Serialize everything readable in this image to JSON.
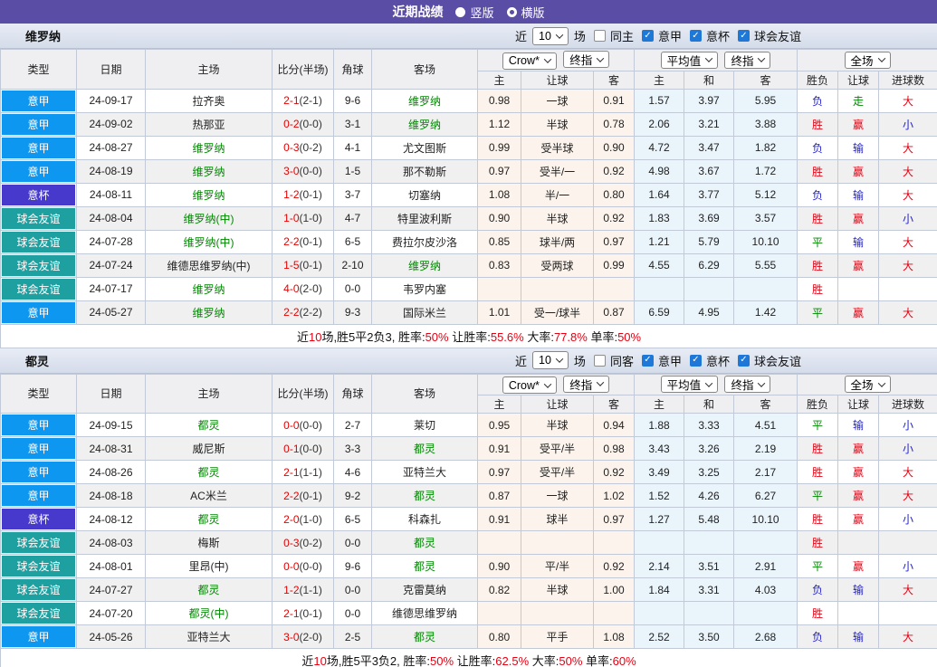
{
  "topbar": {
    "title": "近期战绩",
    "options": [
      {
        "label": "竖版",
        "selected": true
      },
      {
        "label": "横版",
        "selected": false
      }
    ]
  },
  "filter_labels": {
    "near": "近",
    "count": "10",
    "games": "场",
    "leagues": [
      "意甲",
      "意杯",
      "球会友谊"
    ]
  },
  "header": {
    "static_cols": [
      "类型",
      "日期",
      "主场",
      "比分(半场)",
      "角球",
      "客场"
    ],
    "odds_selects": [
      "Crow*",
      "终指"
    ],
    "odds_cols": [
      "主",
      "让球",
      "客"
    ],
    "avg_selects": [
      "平均值",
      "终指"
    ],
    "avg_cols": [
      "主",
      "和",
      "客"
    ],
    "full_select": "全场",
    "full_cols": [
      "胜负",
      "让球",
      "进球数"
    ]
  },
  "colors": {
    "league_type": {
      "意甲": "#0d97f0",
      "意杯": "#4639cc",
      "球会友谊": "#1fa0a0"
    },
    "outcome": {
      "red": "#e60012",
      "green": "#008800",
      "blue": "#2323cc"
    },
    "focal_team": "#008800",
    "score_fulltime": "#e60000",
    "topbar_bg": "#5a4da6"
  },
  "teams": [
    {
      "name": "维罗纳",
      "same_side_label": "同主",
      "rows": [
        {
          "type": "意甲",
          "date": "24-09-17",
          "home": "拉齐奥",
          "home_focal": false,
          "score": "2-1",
          "half": "(2-1)",
          "corners": "9-6",
          "away": "维罗纳",
          "away_focal": true,
          "odds": [
            "0.98",
            "一球",
            "0.91"
          ],
          "avg": [
            "1.57",
            "3.97",
            "5.95"
          ],
          "outcomes": [
            "负",
            "走",
            "大"
          ]
        },
        {
          "type": "意甲",
          "date": "24-09-02",
          "home": "热那亚",
          "home_focal": false,
          "score": "0-2",
          "half": "(0-0)",
          "corners": "3-1",
          "away": "维罗纳",
          "away_focal": true,
          "odds": [
            "1.12",
            "半球",
            "0.78"
          ],
          "avg": [
            "2.06",
            "3.21",
            "3.88"
          ],
          "outcomes": [
            "胜",
            "赢",
            "小"
          ]
        },
        {
          "type": "意甲",
          "date": "24-08-27",
          "home": "维罗纳",
          "home_focal": true,
          "score": "0-3",
          "half": "(0-2)",
          "corners": "4-1",
          "away": "尤文图斯",
          "away_focal": false,
          "odds": [
            "0.99",
            "受半球",
            "0.90"
          ],
          "avg": [
            "4.72",
            "3.47",
            "1.82"
          ],
          "outcomes": [
            "负",
            "输",
            "大"
          ]
        },
        {
          "type": "意甲",
          "date": "24-08-19",
          "home": "维罗纳",
          "home_focal": true,
          "score": "3-0",
          "half": "(0-0)",
          "corners": "1-5",
          "away": "那不勒斯",
          "away_focal": false,
          "odds": [
            "0.97",
            "受半/一",
            "0.92"
          ],
          "avg": [
            "4.98",
            "3.67",
            "1.72"
          ],
          "outcomes": [
            "胜",
            "赢",
            "大"
          ]
        },
        {
          "type": "意杯",
          "date": "24-08-11",
          "home": "维罗纳",
          "home_focal": true,
          "score": "1-2",
          "half": "(0-1)",
          "corners": "3-7",
          "away": "切塞纳",
          "away_focal": false,
          "odds": [
            "1.08",
            "半/一",
            "0.80"
          ],
          "avg": [
            "1.64",
            "3.77",
            "5.12"
          ],
          "outcomes": [
            "负",
            "输",
            "大"
          ]
        },
        {
          "type": "球会友谊",
          "date": "24-08-04",
          "home": "维罗纳(中)",
          "home_focal": true,
          "score": "1-0",
          "half": "(1-0)",
          "corners": "4-7",
          "away": "特里波利斯",
          "away_focal": false,
          "odds": [
            "0.90",
            "半球",
            "0.92"
          ],
          "avg": [
            "1.83",
            "3.69",
            "3.57"
          ],
          "outcomes": [
            "胜",
            "赢",
            "小"
          ]
        },
        {
          "type": "球会友谊",
          "date": "24-07-28",
          "home": "维罗纳(中)",
          "home_focal": true,
          "score": "2-2",
          "half": "(0-1)",
          "corners": "6-5",
          "away": "费拉尔皮沙洛",
          "away_focal": false,
          "odds": [
            "0.85",
            "球半/两",
            "0.97"
          ],
          "avg": [
            "1.21",
            "5.79",
            "10.10"
          ],
          "outcomes": [
            "平",
            "输",
            "大"
          ]
        },
        {
          "type": "球会友谊",
          "date": "24-07-24",
          "home": "维德思维罗纳(中)",
          "home_focal": false,
          "score": "1-5",
          "half": "(0-1)",
          "corners": "2-10",
          "away": "维罗纳",
          "away_focal": true,
          "odds": [
            "0.83",
            "受两球",
            "0.99"
          ],
          "avg": [
            "4.55",
            "6.29",
            "5.55"
          ],
          "outcomes": [
            "胜",
            "赢",
            "大"
          ]
        },
        {
          "type": "球会友谊",
          "date": "24-07-17",
          "home": "维罗纳",
          "home_focal": true,
          "score": "4-0",
          "half": "(2-0)",
          "corners": "0-0",
          "away": "韦罗内塞",
          "away_focal": false,
          "odds": [
            "",
            "",
            ""
          ],
          "avg": [
            "",
            "",
            ""
          ],
          "outcomes": [
            "胜",
            "",
            ""
          ]
        },
        {
          "type": "意甲",
          "date": "24-05-27",
          "home": "维罗纳",
          "home_focal": true,
          "score": "2-2",
          "half": "(2-2)",
          "corners": "9-3",
          "away": "国际米兰",
          "away_focal": false,
          "odds": [
            "1.01",
            "受一/球半",
            "0.87"
          ],
          "avg": [
            "6.59",
            "4.95",
            "1.42"
          ],
          "outcomes": [
            "平",
            "赢",
            "大"
          ]
        }
      ],
      "summary": [
        {
          "t": "近",
          "hl": false
        },
        {
          "t": "10",
          "hl": true
        },
        {
          "t": "场,胜5平2负3, 胜率:",
          "hl": false
        },
        {
          "t": "50%",
          "hl": true
        },
        {
          "t": " 让胜率:",
          "hl": false
        },
        {
          "t": "55.6%",
          "hl": true
        },
        {
          "t": " 大率:",
          "hl": false
        },
        {
          "t": "77.8%",
          "hl": true
        },
        {
          "t": " 单率:",
          "hl": false
        },
        {
          "t": "50%",
          "hl": true
        }
      ]
    },
    {
      "name": "都灵",
      "same_side_label": "同客",
      "rows": [
        {
          "type": "意甲",
          "date": "24-09-15",
          "home": "都灵",
          "home_focal": true,
          "score": "0-0",
          "half": "(0-0)",
          "corners": "2-7",
          "away": "莱切",
          "away_focal": false,
          "odds": [
            "0.95",
            "半球",
            "0.94"
          ],
          "avg": [
            "1.88",
            "3.33",
            "4.51"
          ],
          "outcomes": [
            "平",
            "输",
            "小"
          ]
        },
        {
          "type": "意甲",
          "date": "24-08-31",
          "home": "威尼斯",
          "home_focal": false,
          "score": "0-1",
          "half": "(0-0)",
          "corners": "3-3",
          "away": "都灵",
          "away_focal": true,
          "odds": [
            "0.91",
            "受平/半",
            "0.98"
          ],
          "avg": [
            "3.43",
            "3.26",
            "2.19"
          ],
          "outcomes": [
            "胜",
            "赢",
            "小"
          ]
        },
        {
          "type": "意甲",
          "date": "24-08-26",
          "home": "都灵",
          "home_focal": true,
          "score": "2-1",
          "half": "(1-1)",
          "corners": "4-6",
          "away": "亚特兰大",
          "away_focal": false,
          "odds": [
            "0.97",
            "受平/半",
            "0.92"
          ],
          "avg": [
            "3.49",
            "3.25",
            "2.17"
          ],
          "outcomes": [
            "胜",
            "赢",
            "大"
          ]
        },
        {
          "type": "意甲",
          "date": "24-08-18",
          "home": "AC米兰",
          "home_focal": false,
          "score": "2-2",
          "half": "(0-1)",
          "corners": "9-2",
          "away": "都灵",
          "away_focal": true,
          "odds": [
            "0.87",
            "一球",
            "1.02"
          ],
          "avg": [
            "1.52",
            "4.26",
            "6.27"
          ],
          "outcomes": [
            "平",
            "赢",
            "大"
          ]
        },
        {
          "type": "意杯",
          "date": "24-08-12",
          "home": "都灵",
          "home_focal": true,
          "score": "2-0",
          "half": "(1-0)",
          "corners": "6-5",
          "away": "科森扎",
          "away_focal": false,
          "odds": [
            "0.91",
            "球半",
            "0.97"
          ],
          "avg": [
            "1.27",
            "5.48",
            "10.10"
          ],
          "outcomes": [
            "胜",
            "赢",
            "小"
          ]
        },
        {
          "type": "球会友谊",
          "date": "24-08-03",
          "home": "梅斯",
          "home_focal": false,
          "score": "0-3",
          "half": "(0-2)",
          "corners": "0-0",
          "away": "都灵",
          "away_focal": true,
          "odds": [
            "",
            "",
            ""
          ],
          "avg": [
            "",
            "",
            ""
          ],
          "outcomes": [
            "胜",
            "",
            ""
          ]
        },
        {
          "type": "球会友谊",
          "date": "24-08-01",
          "home": "里昂(中)",
          "home_focal": false,
          "score": "0-0",
          "half": "(0-0)",
          "corners": "9-6",
          "away": "都灵",
          "away_focal": true,
          "odds": [
            "0.90",
            "平/半",
            "0.92"
          ],
          "avg": [
            "2.14",
            "3.51",
            "2.91"
          ],
          "outcomes": [
            "平",
            "赢",
            "小"
          ]
        },
        {
          "type": "球会友谊",
          "date": "24-07-27",
          "home": "都灵",
          "home_focal": true,
          "score": "1-2",
          "half": "(1-1)",
          "corners": "0-0",
          "away": "克雷莫纳",
          "away_focal": false,
          "odds": [
            "0.82",
            "半球",
            "1.00"
          ],
          "avg": [
            "1.84",
            "3.31",
            "4.03"
          ],
          "outcomes": [
            "负",
            "输",
            "大"
          ]
        },
        {
          "type": "球会友谊",
          "date": "24-07-20",
          "home": "都灵(中)",
          "home_focal": true,
          "score": "2-1",
          "half": "(0-1)",
          "corners": "0-0",
          "away": "维德思维罗纳",
          "away_focal": false,
          "odds": [
            "",
            "",
            ""
          ],
          "avg": [
            "",
            "",
            ""
          ],
          "outcomes": [
            "胜",
            "",
            ""
          ]
        },
        {
          "type": "意甲",
          "date": "24-05-26",
          "home": "亚特兰大",
          "home_focal": false,
          "score": "3-0",
          "half": "(2-0)",
          "corners": "2-5",
          "away": "都灵",
          "away_focal": true,
          "odds": [
            "0.80",
            "平手",
            "1.08"
          ],
          "avg": [
            "2.52",
            "3.50",
            "2.68"
          ],
          "outcomes": [
            "负",
            "输",
            "大"
          ]
        }
      ],
      "summary": [
        {
          "t": "近",
          "hl": false
        },
        {
          "t": "10",
          "hl": true
        },
        {
          "t": "场,胜5平3负2, 胜率:",
          "hl": false
        },
        {
          "t": "50%",
          "hl": true
        },
        {
          "t": " 让胜率:",
          "hl": false
        },
        {
          "t": "62.5%",
          "hl": true
        },
        {
          "t": " 大率:",
          "hl": false
        },
        {
          "t": "50%",
          "hl": true
        },
        {
          "t": " 单率:",
          "hl": false
        },
        {
          "t": "60%",
          "hl": true
        }
      ]
    }
  ]
}
